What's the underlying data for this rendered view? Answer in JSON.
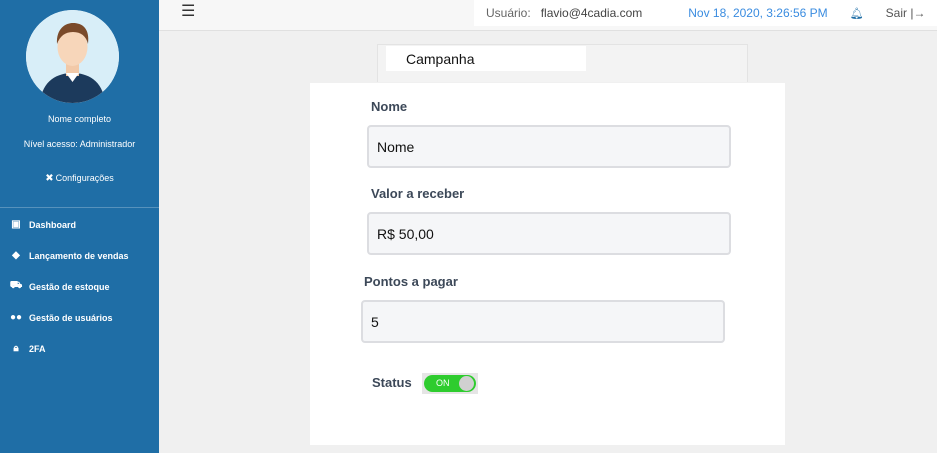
{
  "sidebar": {
    "profile_name": "Nome completo",
    "access_level": "Nível acesso: Administrador",
    "config_label": "Configurações",
    "items": [
      {
        "label": "Dashboard",
        "icon": "dashboard-icon"
      },
      {
        "label": "Lançamento de vendas",
        "icon": "tag-icon"
      },
      {
        "label": "Gestão de estoque",
        "icon": "cart-icon"
      },
      {
        "label": "Gestão de usuários",
        "icon": "users-icon"
      },
      {
        "label": "2FA",
        "icon": "lock-icon"
      }
    ],
    "bg_color": "#1f6ea6"
  },
  "topbar": {
    "user_label": "Usuário:",
    "user_email": "flavio@4cadia.com",
    "datetime": "Nov 18, 2020, 3:26:56 PM",
    "logout_label": "Sair"
  },
  "tab": {
    "label": "Campanha"
  },
  "form": {
    "nome": {
      "label": "Nome",
      "value": "Nome"
    },
    "valor": {
      "label": "Valor a receber",
      "value": "R$ 50,00"
    },
    "pontos": {
      "label": "Pontos a pagar",
      "value": "5"
    },
    "status": {
      "label": "Status",
      "toggle_text": "ON",
      "on": true
    }
  }
}
